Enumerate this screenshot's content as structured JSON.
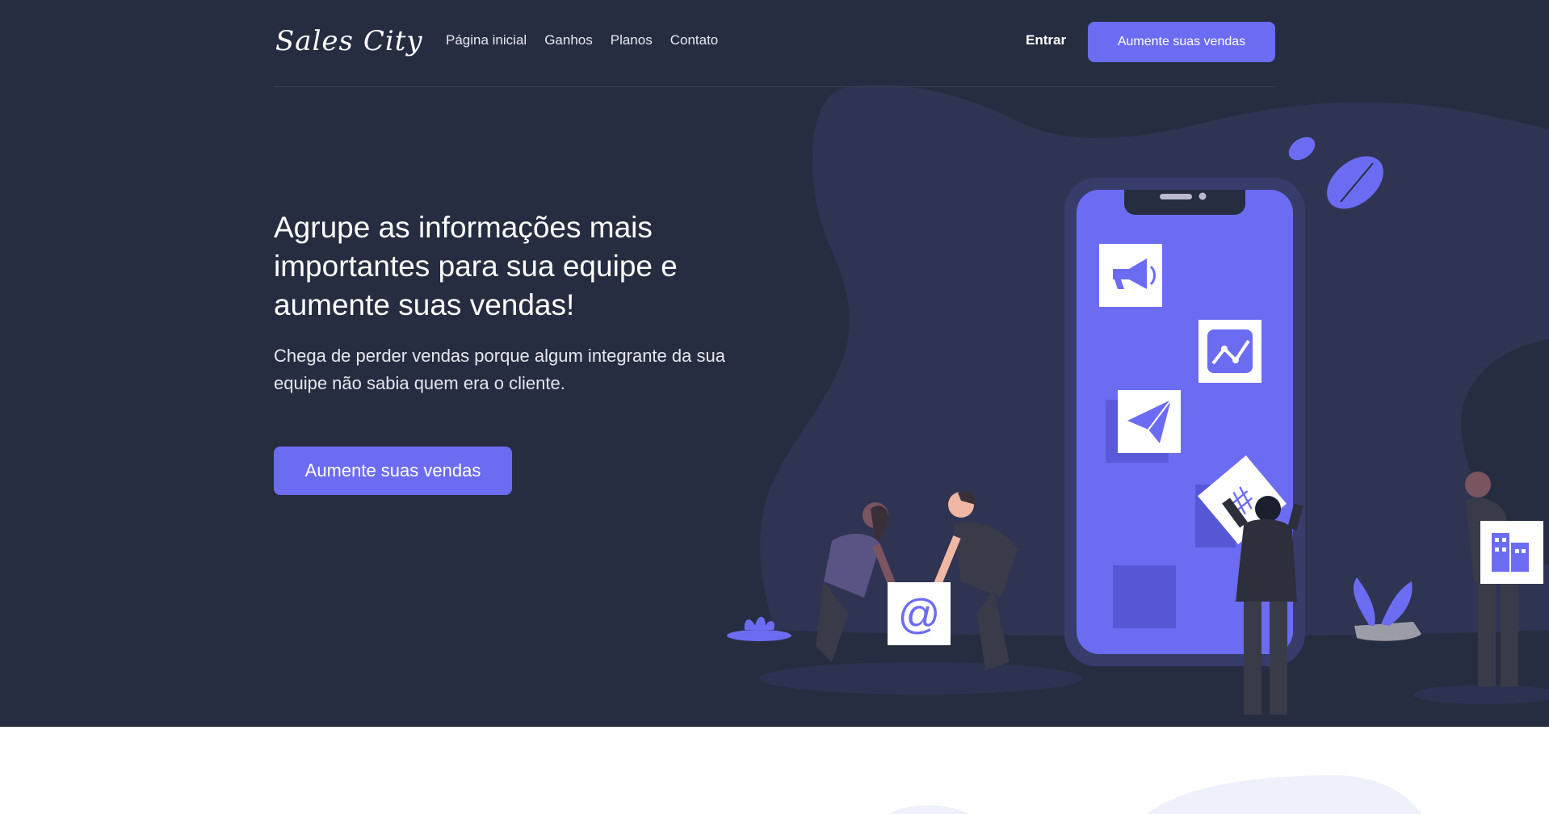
{
  "brand": {
    "logo_text": "Sales City"
  },
  "nav": {
    "links": [
      "Página inicial",
      "Ganhos",
      "Planos",
      "Contato"
    ],
    "login_label": "Entrar",
    "cta_label": "Aumente suas vendas"
  },
  "hero": {
    "title_line1": "Agrupe as informações mais",
    "title_line2": "importantes para sua equipe e",
    "title_line3": "aumente suas vendas!",
    "subtitle": "Chega de perder vendas porque algum integrante da sua equipe não sabia quem era o cliente.",
    "cta_label": "Aumente suas vendas"
  },
  "illustration": {
    "icons": [
      "megaphone-icon",
      "chart-icon",
      "paper-plane-icon",
      "at-icon",
      "building-icon",
      "hashtag-icon"
    ],
    "at_symbol": "@"
  },
  "colors": {
    "hero_bg": "#262d40",
    "accent": "#6c6cf2",
    "blob": "#2f3452",
    "white": "#ffffff"
  }
}
